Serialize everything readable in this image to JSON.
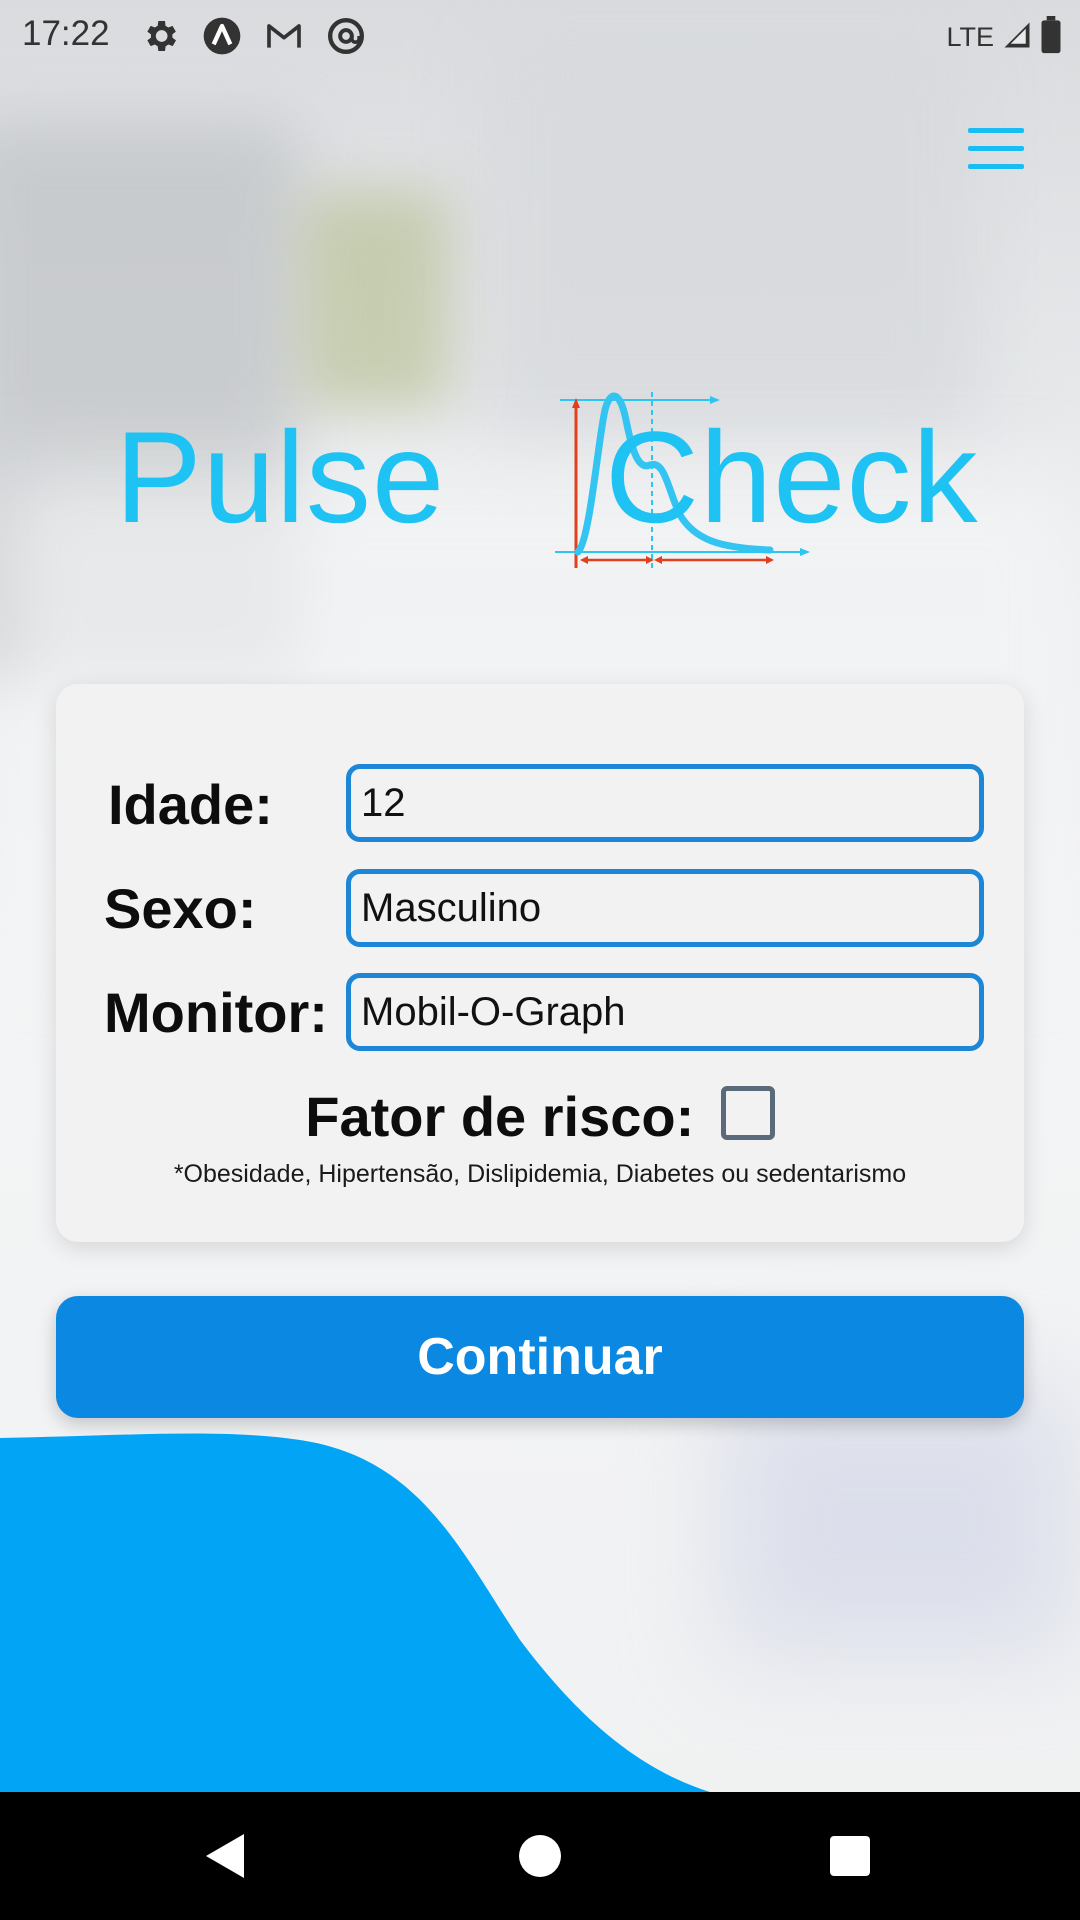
{
  "status_bar": {
    "time": "17:22",
    "network": "LTE",
    "icons": [
      "settings-icon",
      "app-a-icon",
      "gmail-icon",
      "at-sign-icon",
      "signal-icon",
      "battery-icon"
    ]
  },
  "header": {
    "menu_icon": "hamburger-menu-icon"
  },
  "logo": {
    "word1": "Pulse",
    "word2": "Check",
    "color": "#1ec3f4"
  },
  "form": {
    "age_label": "Idade:",
    "age_value": "12",
    "sex_label": "Sexo:",
    "sex_value": "Masculino",
    "monitor_label": "Monitor:",
    "monitor_value": "Mobil-O-Graph",
    "risk_label": "Fator de risco:",
    "risk_checked": false,
    "risk_note": "*Obesidade, Hipertensão, Dislipidemia, Diabetes ou sedentarismo"
  },
  "continue_button": {
    "label": "Continuar",
    "color": "#0a88e2"
  },
  "nav_bar": {
    "back_icon": "back-triangle-icon",
    "home_icon": "home-circle-icon",
    "recents_icon": "recents-square-icon"
  },
  "accent_colors": {
    "field_border": "#1d86d6",
    "wave": "#02a4f6"
  }
}
